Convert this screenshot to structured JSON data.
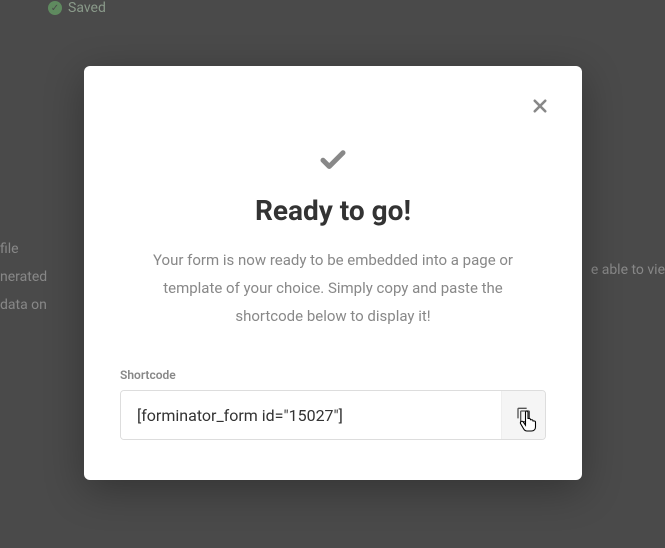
{
  "background": {
    "saved_label": "Saved",
    "left_text_1": "file",
    "left_text_2": "nerated",
    "left_text_3": "data on",
    "right_text": "e able to vie"
  },
  "modal": {
    "title": "Ready to go!",
    "description": "Your form is now ready to be embedded into a page or template of your choice. Simply copy and paste the shortcode below to display it!",
    "shortcode_label": "Shortcode",
    "shortcode_value": "[forminator_form id=\"15027\"]"
  }
}
